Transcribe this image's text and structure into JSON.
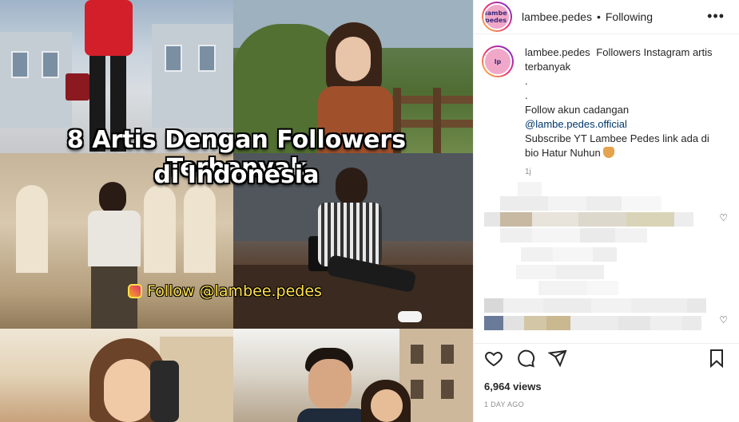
{
  "media": {
    "overlay_title_line1": "8 Artis Dengan Followers Terbanyak",
    "overlay_title_line2": "di Indonesia",
    "follow_badge": "Follow @lambee.pedes"
  },
  "header": {
    "avatar_text": "lambe pedes",
    "username": "lambee.pedes",
    "separator": "•",
    "following_label": "Following",
    "more_icon": "more-horizontal-icon"
  },
  "caption": {
    "username": "lambee.pedes",
    "line1": "Followers Instagram artis terbanyak",
    "dot1": ".",
    "dot2": ".",
    "line2": "Follow akun cadangan",
    "link": "@lambe.pedes.official",
    "line3": "Subscribe YT Lambee Pedes link ada di bio Hatur Nuhun",
    "emoji_icon": "folded-hands-icon",
    "time_short": "1j"
  },
  "comments": {
    "heart_icon": "heart-outline-icon"
  },
  "actions": {
    "like_icon": "heart-icon",
    "comment_icon": "comment-icon",
    "share_icon": "send-icon",
    "save_icon": "bookmark-icon"
  },
  "stats": {
    "views": "6,964 views",
    "posted": "1 DAY AGO"
  }
}
